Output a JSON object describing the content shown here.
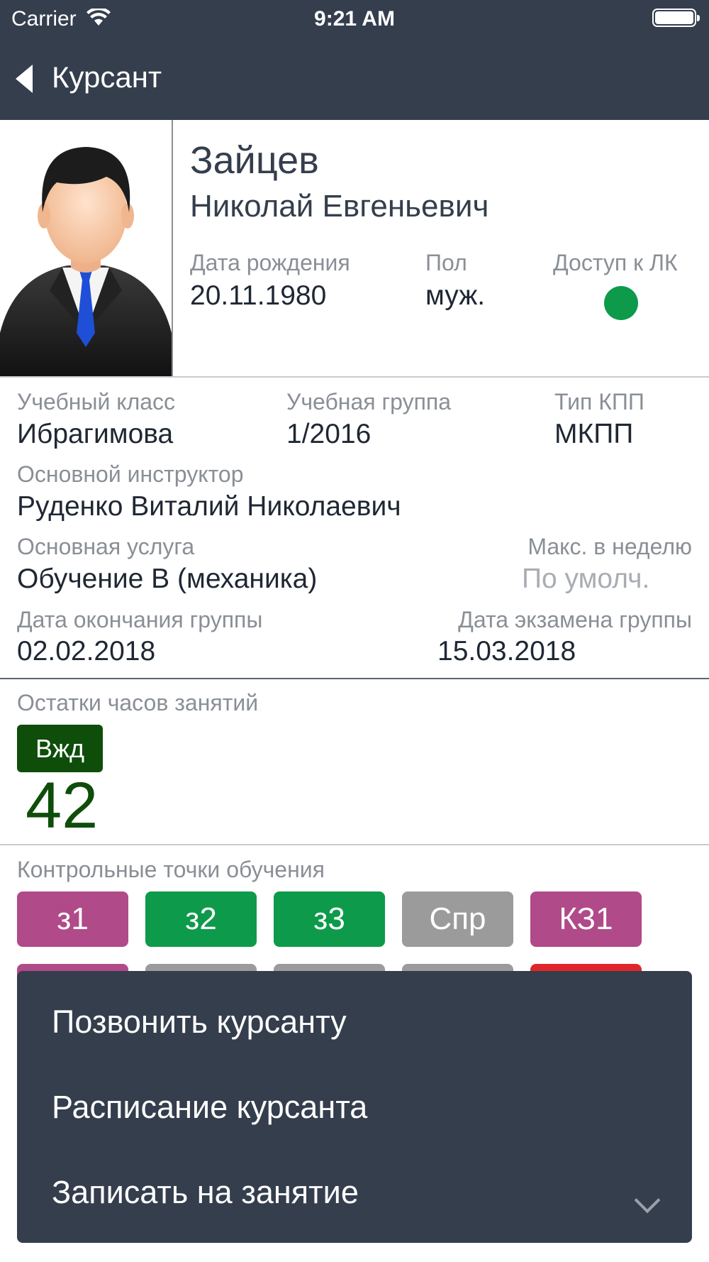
{
  "status_bar": {
    "carrier": "Carrier",
    "time": "9:21 AM"
  },
  "nav": {
    "back_label": "Курсант"
  },
  "student": {
    "last_name": "Зайцев",
    "first_middle_name": "Николай Евгеньевич",
    "birth_label": "Дата рождения",
    "birth_value": "20.11.1980",
    "gender_label": "Пол",
    "gender_value": "муж.",
    "access_label": "Доступ к ЛК",
    "access_color": "#0d9a4a"
  },
  "details": {
    "class_label": "Учебный класс",
    "class_value": "Ибрагимова",
    "group_label": "Учебная группа",
    "group_value": "1/2016",
    "gearbox_label": "Тип КПП",
    "gearbox_value": "МКПП",
    "instructor_label": "Основной инструктор",
    "instructor_value": "Руденко Виталий Николаевич",
    "service_label": "Основная услуга",
    "service_value": "Обучение B (механика)",
    "max_week_label": "Макс. в неделю",
    "max_week_value": "По умолч.",
    "group_end_label": "Дата окончания группы",
    "group_end_value": "02.02.2018",
    "group_exam_label": "Дата экзамена группы",
    "group_exam_value": "15.03.2018"
  },
  "hours": {
    "label": "Остатки часов занятий",
    "badge": "Вжд",
    "value": "42",
    "color": "#0e4d0a"
  },
  "checkpoints": {
    "label": "Контрольные точки обучения",
    "items": [
      {
        "label": "з1",
        "color": "#b04a88"
      },
      {
        "label": "з2",
        "color": "#0d9a4a"
      },
      {
        "label": "з3",
        "color": "#0d9a4a"
      },
      {
        "label": "Спр",
        "color": "#9b9b9b"
      },
      {
        "label": "КЗ1",
        "color": "#b04a88"
      }
    ],
    "second_row_colors": [
      "#b04a88",
      "#9b9b9b",
      "#9b9b9b",
      "#9b9b9b",
      "#e0262b"
    ]
  },
  "menu": {
    "items": [
      "Позвонить курсанту",
      "Расписание курсанта",
      "Записать на занятие"
    ]
  }
}
